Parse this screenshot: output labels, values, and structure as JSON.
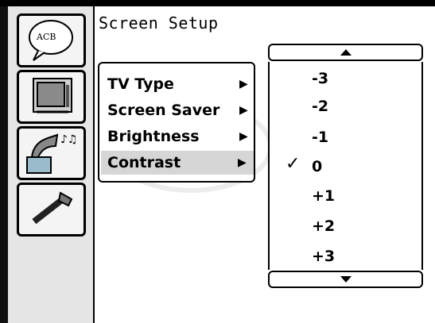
{
  "title": "Screen Setup",
  "categories": [
    {
      "name": "language-category",
      "icon": "abc-speech-bubble-icon",
      "bubble_text": "ACB"
    },
    {
      "name": "screen-category",
      "icon": "tv-screen-icon"
    },
    {
      "name": "audio-category",
      "icon": "gramophone-icon"
    },
    {
      "name": "tools-category",
      "icon": "hammer-icon"
    }
  ],
  "menu": {
    "items": [
      {
        "label": "TV Type",
        "arrow": "▶"
      },
      {
        "label": "Screen Saver",
        "arrow": "▶"
      },
      {
        "label": "Brightness",
        "arrow": "▶"
      },
      {
        "label": "Contrast",
        "arrow": "▶",
        "selected": true
      }
    ]
  },
  "values": {
    "options": [
      "-3",
      "-2",
      "-1",
      "0",
      "+1",
      "+2",
      "+3"
    ],
    "selected": "0",
    "check_mark": "✓"
  }
}
